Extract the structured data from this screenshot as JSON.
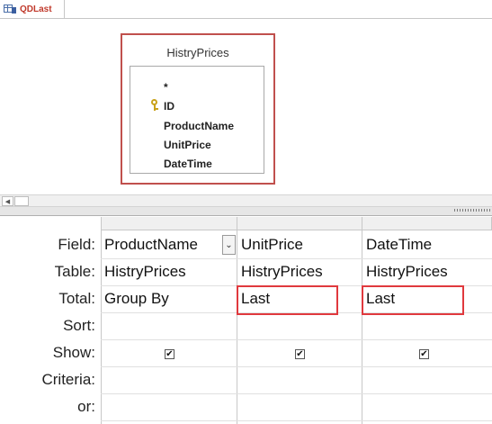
{
  "tab": {
    "label": "QDLast",
    "icon": "query-design-icon"
  },
  "table_box": {
    "title": "HistryPrices",
    "fields": [
      "*",
      "ID",
      "ProductName",
      "UnitPrice",
      "DateTime"
    ],
    "key_icon": "primary-key-icon"
  },
  "grid": {
    "row_labels": {
      "field": "Field:",
      "table": "Table:",
      "total": "Total:",
      "sort": "Sort:",
      "show": "Show:",
      "criteria": "Criteria:",
      "or": "or:"
    },
    "columns": [
      {
        "field": "ProductName",
        "table": "HistryPrices",
        "total": "Group By",
        "sort": "",
        "show": true,
        "criteria": "",
        "or": ""
      },
      {
        "field": "UnitPrice",
        "table": "HistryPrices",
        "total": "Last",
        "sort": "",
        "show": true,
        "criteria": "",
        "or": ""
      },
      {
        "field": "DateTime",
        "table": "HistryPrices",
        "total": "Last",
        "sort": "",
        "show": true,
        "criteria": "",
        "or": ""
      }
    ],
    "dropdown_icon": "chevron-down-icon",
    "checkbox_glyph": "✔"
  },
  "colors": {
    "highlight": "#e0393e",
    "table_border": "#c0504d",
    "tab_label": "#c0392b"
  }
}
